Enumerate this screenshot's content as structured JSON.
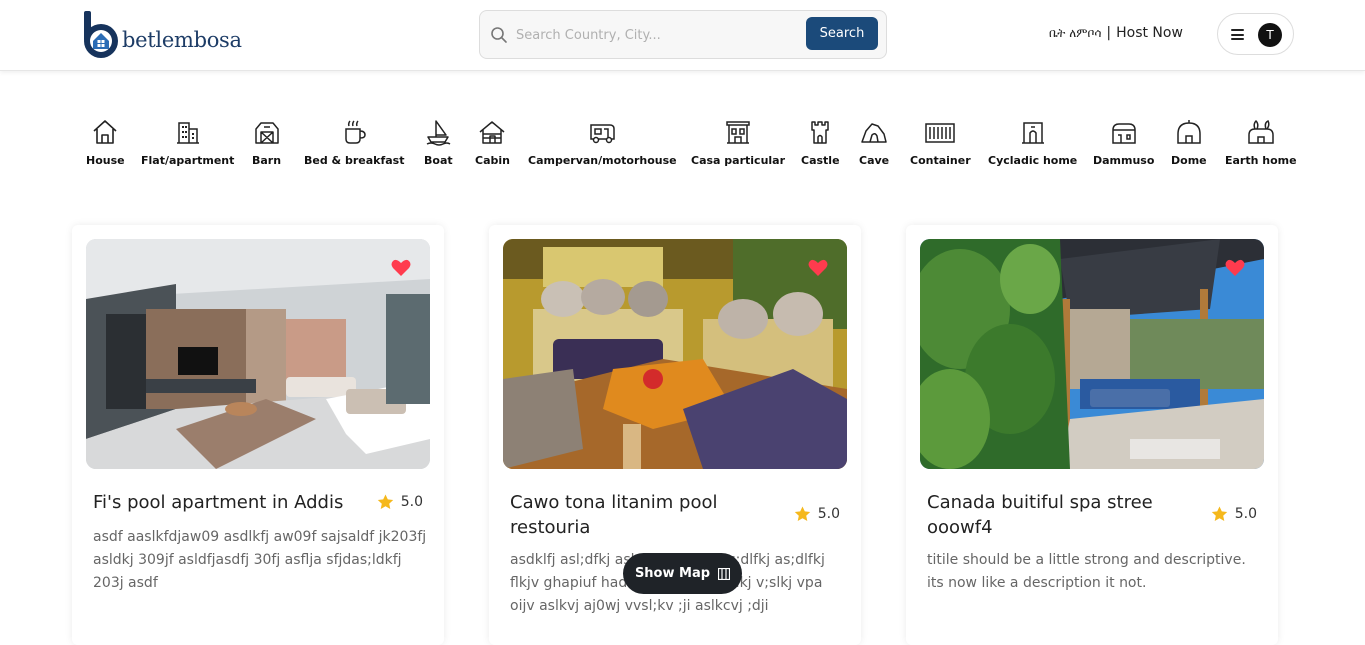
{
  "header": {
    "brand_name": "betlembosa",
    "search": {
      "placeholder": "Search Country, City...",
      "value": "",
      "button_label": "Search"
    },
    "lang_link": "ቤት ለምቦሳ",
    "separator": "|",
    "host_link": "Host Now",
    "avatar_initial": "T"
  },
  "categories": [
    {
      "label": "House",
      "icon": "house-icon"
    },
    {
      "label": "Flat/apartment",
      "icon": "apartment-icon"
    },
    {
      "label": "Barn",
      "icon": "barn-icon"
    },
    {
      "label": "Bed & breakfast",
      "icon": "coffee-cup-icon"
    },
    {
      "label": "Boat",
      "icon": "boat-icon"
    },
    {
      "label": "Cabin",
      "icon": "cabin-icon"
    },
    {
      "label": "Campervan/motorhouse",
      "icon": "camper-icon"
    },
    {
      "label": "Casa particular",
      "icon": "casa-icon"
    },
    {
      "label": "Castle",
      "icon": "castle-icon"
    },
    {
      "label": "Cave",
      "icon": "cave-icon"
    },
    {
      "label": "Container",
      "icon": "container-icon"
    },
    {
      "label": "Cycladic home",
      "icon": "cycladic-icon"
    },
    {
      "label": "Dammuso",
      "icon": "dammuso-icon"
    },
    {
      "label": "Dome",
      "icon": "dome-icon"
    },
    {
      "label": "Earth home",
      "icon": "earth-home-icon"
    }
  ],
  "listings": [
    {
      "title": "Fi's pool apartment in Addis",
      "rating": "5.0",
      "description": "asdf aaslkfdjaw09 asdlkfj aw09f sajsaldf jk203fj asldkj 309jf asldfjasdfj 30fj asflja sfjdas;ldkfj 203j asdf",
      "favorited": true
    },
    {
      "title": "Cawo tona litanim pool restouria",
      "rating": "5.0",
      "description": "asdklfj asl;dfkj asl;dkfjas;dlfkj as;dlfkj as;dlfkj flkjv ghapiuf hadskjfh asdkjfu aslkj v;slkj vpa oijv aslkvj aj0wj vvsl;kv ;ji aslkcvj ;dji",
      "favorited": true
    },
    {
      "title": "Canada buitiful spa stree ooowf4",
      "rating": "5.0",
      "description": "titile should be a little strong and descriptive. its now like a description it not.",
      "favorited": true
    }
  ],
  "show_map_label": "Show Map",
  "colors": {
    "brand": "#1b4a7a",
    "heart": "#ff3b4e",
    "star": "#f5b81c"
  }
}
